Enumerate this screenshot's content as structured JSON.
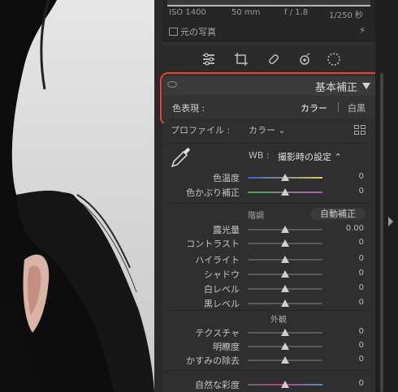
{
  "exif": {
    "iso": "ISO 1400",
    "focal": "50 mm",
    "aperture": "f / 1.8",
    "shutter": "1/250 秒"
  },
  "original": {
    "label": "元の写真"
  },
  "panel": {
    "title": "基本補正"
  },
  "treatment": {
    "label": "色表現 :",
    "color": "カラー",
    "bw": "白黒"
  },
  "profile": {
    "label": "プロファイル :",
    "value": "カラー ⌄"
  },
  "wb": {
    "label": "WB :",
    "value": "撮影時の設定 ⌃"
  },
  "color_sliders": [
    {
      "label": "色温度",
      "value": "0",
      "pos": 0.5
    },
    {
      "label": "色かぶり補正",
      "value": "0",
      "pos": 0.5
    }
  ],
  "tone": {
    "title": "階調",
    "auto": "自動補正",
    "sliders": [
      {
        "label": "露光量",
        "value": "0.00",
        "pos": 0.5
      },
      {
        "label": "コントラスト",
        "value": "0",
        "pos": 0.5
      },
      {
        "label": "ハイライト",
        "value": "0",
        "pos": 0.5
      },
      {
        "label": "シャドウ",
        "value": "0",
        "pos": 0.5
      },
      {
        "label": "白レベル",
        "value": "0",
        "pos": 0.5
      },
      {
        "label": "黒レベル",
        "value": "0",
        "pos": 0.5
      }
    ]
  },
  "presence": {
    "title": "外観",
    "sliders": [
      {
        "label": "テクスチャ",
        "value": "0",
        "pos": 0.5
      },
      {
        "label": "明瞭度",
        "value": "0",
        "pos": 0.5
      },
      {
        "label": "かすみの除去",
        "value": "0",
        "pos": 0.5
      },
      {
        "label": "自然な彩度",
        "value": "0",
        "pos": 0.5
      }
    ]
  },
  "colors": {
    "highlight": "#e8442c"
  }
}
